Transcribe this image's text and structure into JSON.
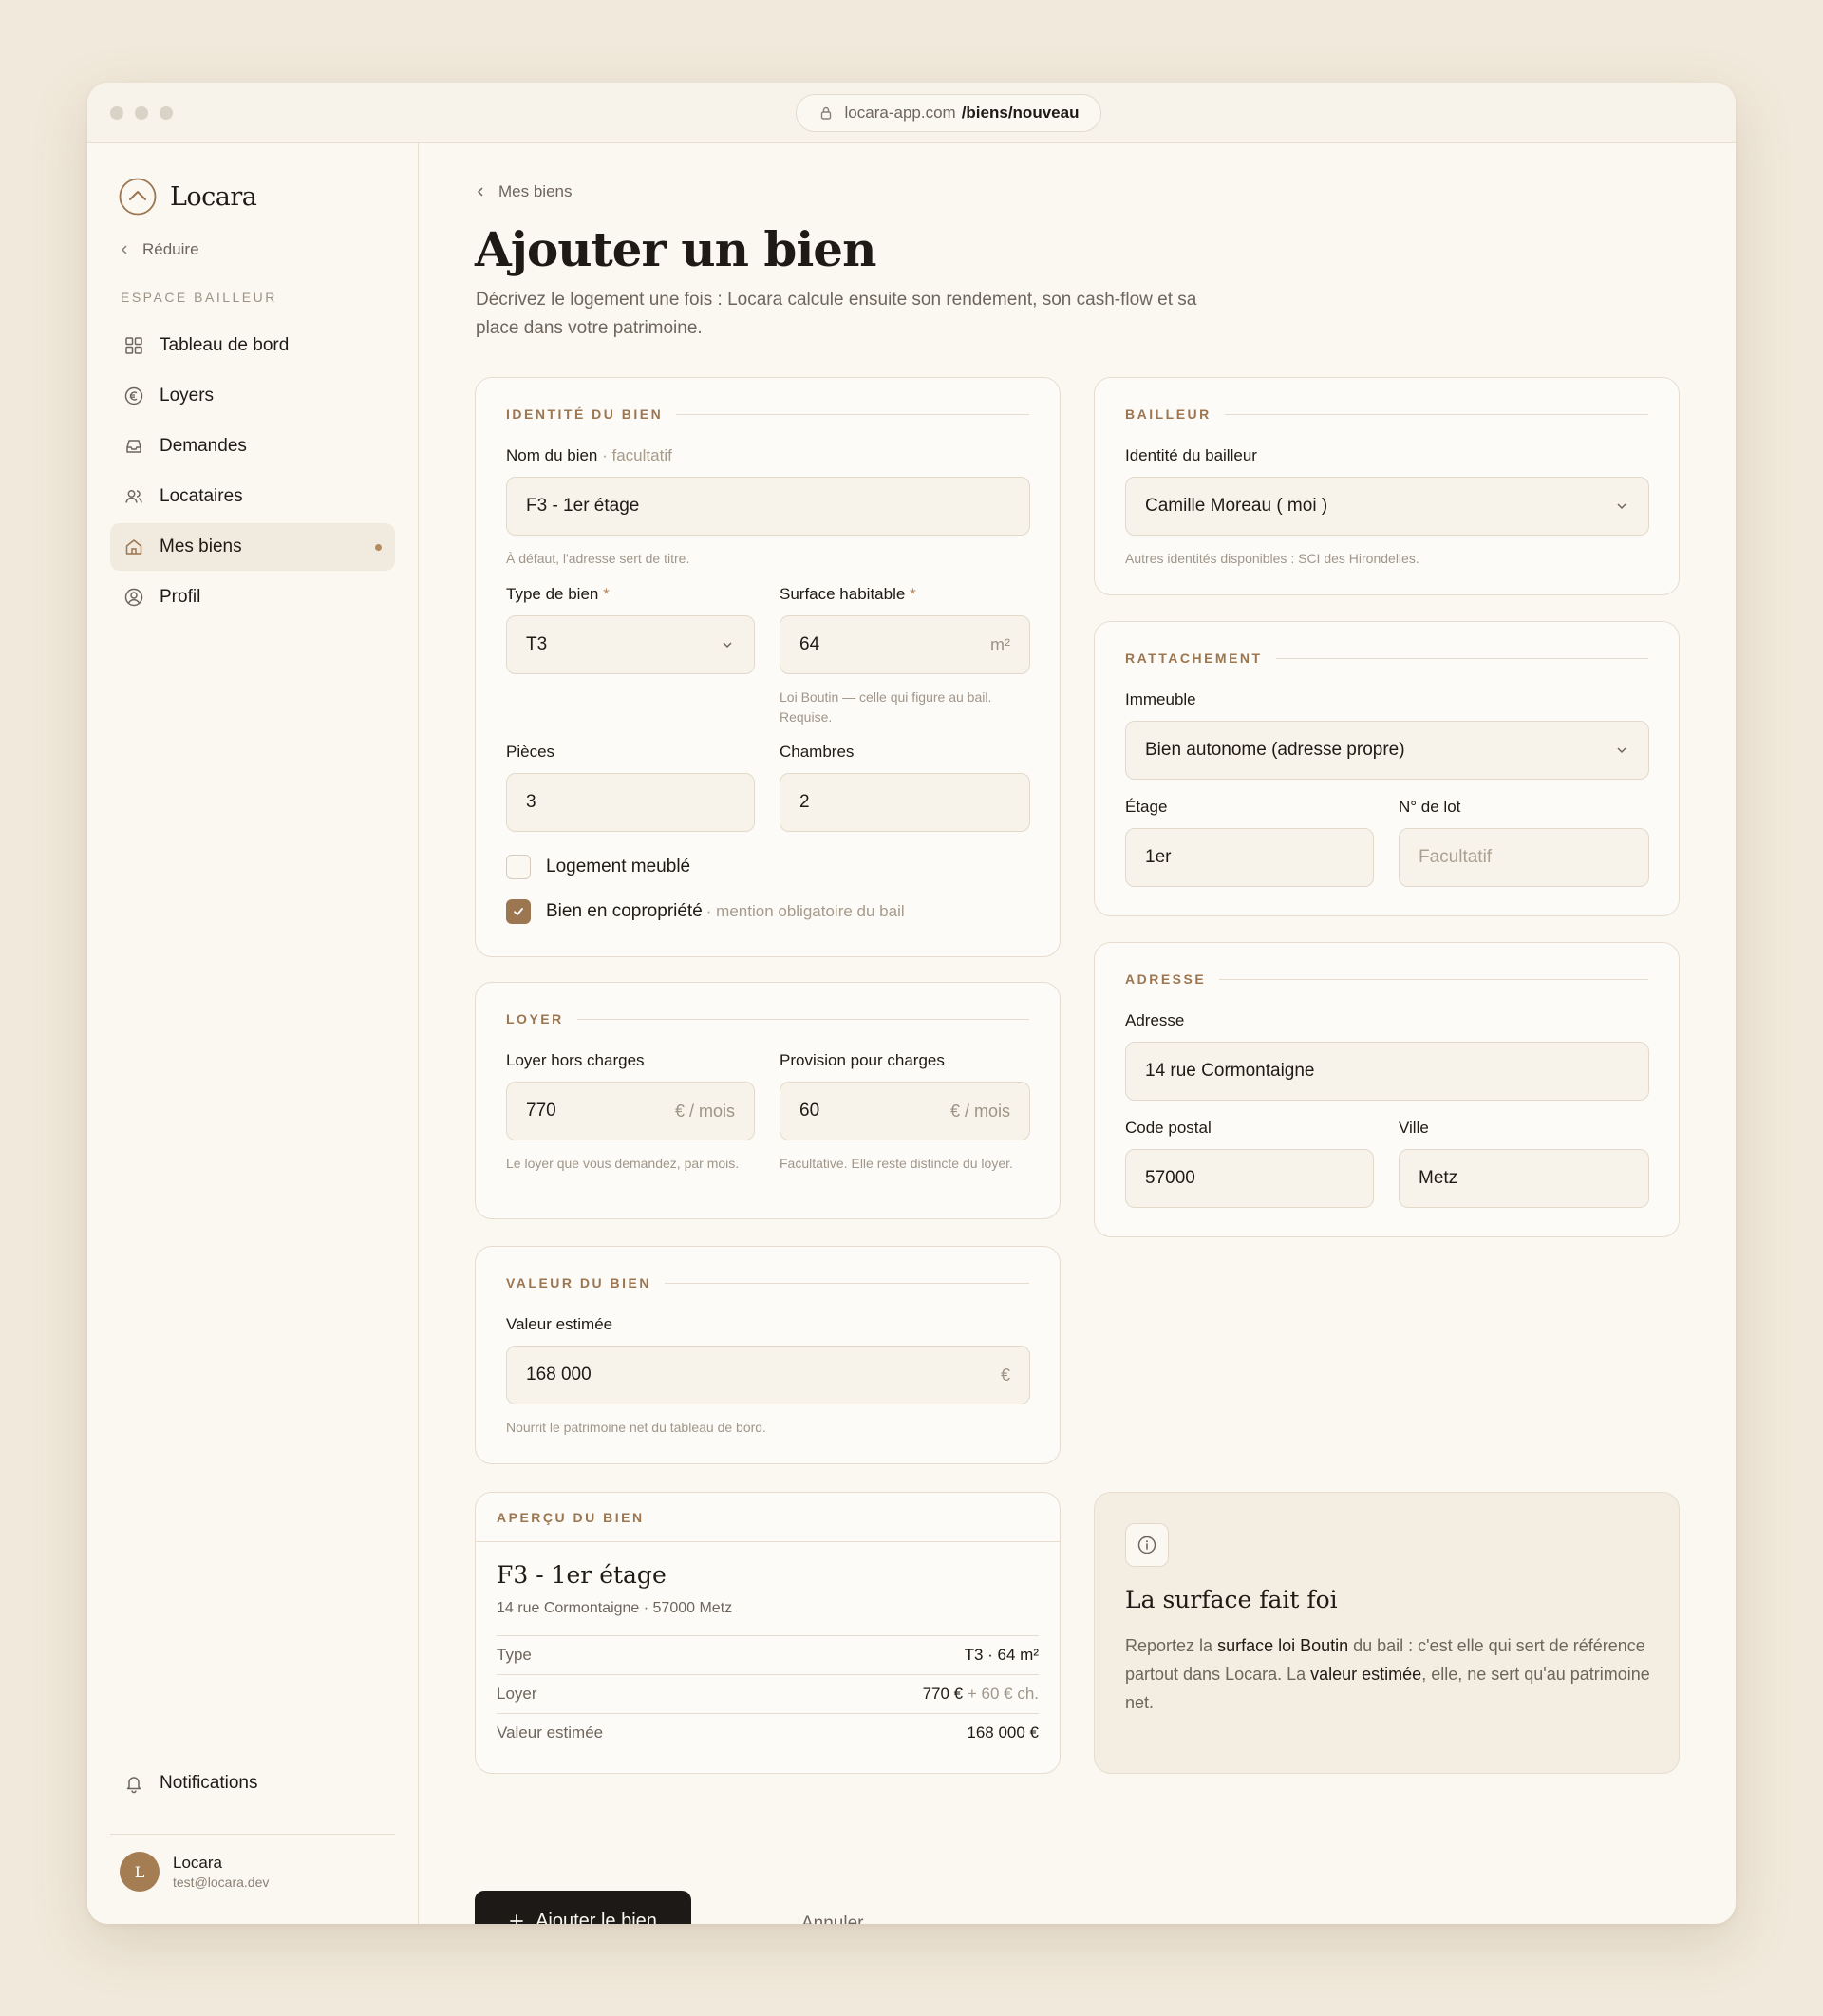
{
  "browser": {
    "url_host": "locara-app.com",
    "url_path": "/biens/nouveau"
  },
  "sidebar": {
    "brand": "Locara",
    "collapse_label": "Réduire",
    "section_label": "ESPACE BAILLEUR",
    "items": [
      {
        "label": "Tableau de bord",
        "icon": "grid-icon"
      },
      {
        "label": "Loyers",
        "icon": "euro-icon"
      },
      {
        "label": "Demandes",
        "icon": "inbox-icon"
      },
      {
        "label": "Locataires",
        "icon": "users-icon"
      },
      {
        "label": "Mes biens",
        "icon": "home-icon",
        "active": true
      },
      {
        "label": "Profil",
        "icon": "profile-icon"
      }
    ],
    "notifications_label": "Notifications",
    "user": {
      "initial": "L",
      "name": "Locara",
      "email": "test@locara.dev"
    }
  },
  "header": {
    "back_label": "Mes biens",
    "title": "Ajouter un bien",
    "subtitle": "Décrivez le logement une fois : Locara calcule ensuite son rendement, son cash-flow et sa place dans votre patrimoine."
  },
  "identite": {
    "heading": "IDENTITÉ DU BIEN",
    "nom_label": "Nom du bien",
    "nom_optional": "· facultatif",
    "nom_value": "F3 - 1er étage",
    "nom_help": "À défaut, l'adresse sert de titre.",
    "type_label": "Type de bien",
    "type_value": "T3",
    "surface_label": "Surface habitable",
    "surface_value": "64",
    "surface_unit": "m²",
    "surface_help": "Loi Boutin — celle qui figure au bail. Requise.",
    "required_mark": "*",
    "pieces_label": "Pièces",
    "pieces_value": "3",
    "chambres_label": "Chambres",
    "chambres_value": "2",
    "meuble_label": "Logement meublé",
    "meuble_checked": false,
    "copro_label": "Bien en copropriété",
    "copro_note": "· mention obligatoire du bail",
    "copro_checked": true
  },
  "loyer": {
    "heading": "LOYER",
    "hc_label": "Loyer hors charges",
    "hc_value": "770",
    "hc_unit": "€ / mois",
    "hc_help": "Le loyer que vous demandez, par mois.",
    "charges_label": "Provision pour charges",
    "charges_value": "60",
    "charges_unit": "€ / mois",
    "charges_help": "Facultative. Elle reste distincte du loyer."
  },
  "valeur": {
    "heading": "VALEUR DU BIEN",
    "label": "Valeur estimée",
    "value": "168 000",
    "unit": "€",
    "help": "Nourrit le patrimoine net du tableau de bord."
  },
  "bailleur": {
    "heading": "BAILLEUR",
    "label": "Identité du bailleur",
    "value": "Camille Moreau ( moi )",
    "help": "Autres identités disponibles : SCI des Hirondelles."
  },
  "rattachement": {
    "heading": "RATTACHEMENT",
    "immeuble_label": "Immeuble",
    "immeuble_value": "Bien autonome (adresse propre)",
    "etage_label": "Étage",
    "etage_value": "1er",
    "lot_label": "N° de lot",
    "lot_placeholder": "Facultatif"
  },
  "adresse": {
    "heading": "ADRESSE",
    "adresse_label": "Adresse",
    "adresse_value": "14 rue Cormontaigne",
    "cp_label": "Code postal",
    "cp_value": "57000",
    "ville_label": "Ville",
    "ville_value": "Metz"
  },
  "apercu": {
    "heading": "APERÇU DU BIEN",
    "title": "F3 - 1er étage",
    "address": "14 rue Cormontaigne · 57000 Metz",
    "rows": [
      {
        "key": "Type",
        "value": "T3 · 64 m²"
      },
      {
        "key": "Loyer",
        "value": "770 €",
        "extra": "+ 60 € ch."
      },
      {
        "key": "Valeur estimée",
        "value": "168 000 €"
      }
    ]
  },
  "info": {
    "title": "La surface fait foi",
    "t1": "Reportez la ",
    "b1": "surface loi Boutin",
    "t2": " du bail : c'est elle qui sert de référence partout dans Locara. La ",
    "b2": "valeur estimée",
    "t3": ", elle, ne sert qu'au patrimoine net."
  },
  "actions": {
    "submit": "Ajouter le bien",
    "cancel": "Annuler"
  },
  "colors": {
    "accent": "#9b7650",
    "background": "#f1e9db",
    "primary_button": "#1d1916"
  }
}
